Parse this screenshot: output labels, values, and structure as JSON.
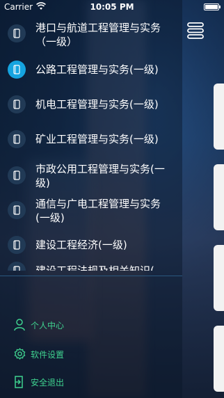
{
  "status_bar": {
    "carrier": "Carrier",
    "time": "10:05 PM"
  },
  "menu": {
    "items": [
      {
        "label_lines": [
          "港口与航道工程管理与实务",
          "（一级）"
        ],
        "active": false
      },
      {
        "label_lines": [
          "公路工程管理与实务(一级)"
        ],
        "active": true
      },
      {
        "label_lines": [
          "机电工程管理与实务(一级)"
        ],
        "active": false
      },
      {
        "label_lines": [
          "矿业工程管理与实务(一级)"
        ],
        "active": false
      },
      {
        "label_lines": [
          "市政公用工程管理与实务(一",
          "级)"
        ],
        "active": false
      },
      {
        "label_lines": [
          "通信与广电工程管理与实务",
          "(一级)"
        ],
        "active": false
      },
      {
        "label_lines": [
          "建设工程经济(一级)"
        ],
        "active": false
      },
      {
        "label_lines": [
          "建设工程法规及相关知识("
        ],
        "active": false
      }
    ]
  },
  "bottom_menu": {
    "profile_label": "个人中心",
    "settings_label": "软件设置",
    "logout_label": "安全退出"
  },
  "icons": {
    "menu_item": "book-icon",
    "profile": "user-icon",
    "settings": "gear-icon",
    "logout": "exit-icon",
    "hamburger": "menu-icon"
  },
  "colors": {
    "active_icon_bg": "#15a4e0",
    "inactive_icon_bg": "#213a56",
    "bottom_menu_text": "#3fd28f",
    "divider": "#2a587f"
  }
}
